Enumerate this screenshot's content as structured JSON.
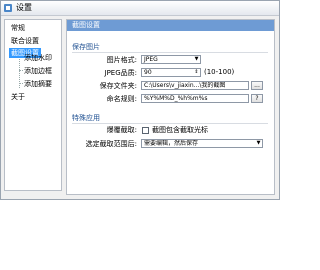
{
  "window": {
    "title": "设置"
  },
  "sidebar": {
    "items": [
      {
        "label": "常规"
      },
      {
        "label": "联合设置"
      },
      {
        "label": "截图设置"
      },
      {
        "label": "添加水印"
      },
      {
        "label": "添加边框"
      },
      {
        "label": "添加摘要"
      },
      {
        "label": "关于"
      }
    ],
    "selected_index": 2
  },
  "content": {
    "header": "截图设置",
    "save_section": {
      "title": "保存图片",
      "format_label": "图片格式:",
      "format_value": "JPEG",
      "quality_label": "JPEG品质:",
      "quality_value": "90",
      "quality_range": "(10-100)",
      "folder_label": "保存文件夹:",
      "folder_value": "C:\\Users\\v_jiaxin...\\我的截图",
      "folder_button": "...",
      "naming_label": "命名规则:",
      "naming_value": "%Y%M%D_%h%m%s",
      "naming_help_button": "?"
    },
    "special_section": {
      "title": "特殊应用",
      "cursor_label": "爆覆截取:",
      "cursor_checkbox_label": "截图包含截取光标",
      "cursor_checked": false,
      "after_label": "选定截取范围后:",
      "after_value": "需要编辑，然后保存"
    }
  },
  "colors": {
    "header_bg": "#6e9bd4",
    "selected_bg": "#3399ff",
    "section_title": "#1e4f91"
  }
}
